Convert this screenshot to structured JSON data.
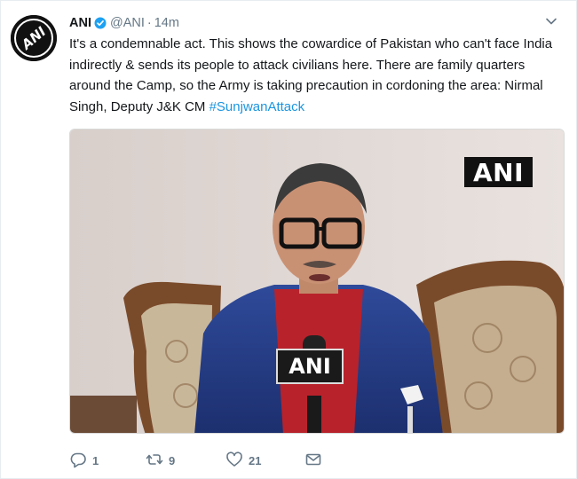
{
  "tweet": {
    "display_name": "ANI",
    "handle": "@ANI",
    "separator": "·",
    "time": "14m",
    "text": "It's a condemnable act. This shows the cowardice of Pakistan who can't face India indirectly & sends its people to attack civilians here. There are family quarters around the Camp, so the Army is taking precaution in cordoning the area: Nirmal Singh, Deputy J&K CM",
    "hashtag": "#SunjwanAttack",
    "media": {
      "watermark": "ANI",
      "mic_label": "ANI"
    },
    "avatar_logo": "ANI",
    "actions": {
      "reply_count": "1",
      "retweet_count": "9",
      "like_count": "21"
    }
  },
  "colors": {
    "link": "#1b95e0",
    "secondary_text": "#657786",
    "verified": "#1da1f2"
  },
  "icons": [
    "verified-icon",
    "caret-down-icon",
    "reply-icon",
    "retweet-icon",
    "like-icon",
    "direct-message-icon"
  ]
}
